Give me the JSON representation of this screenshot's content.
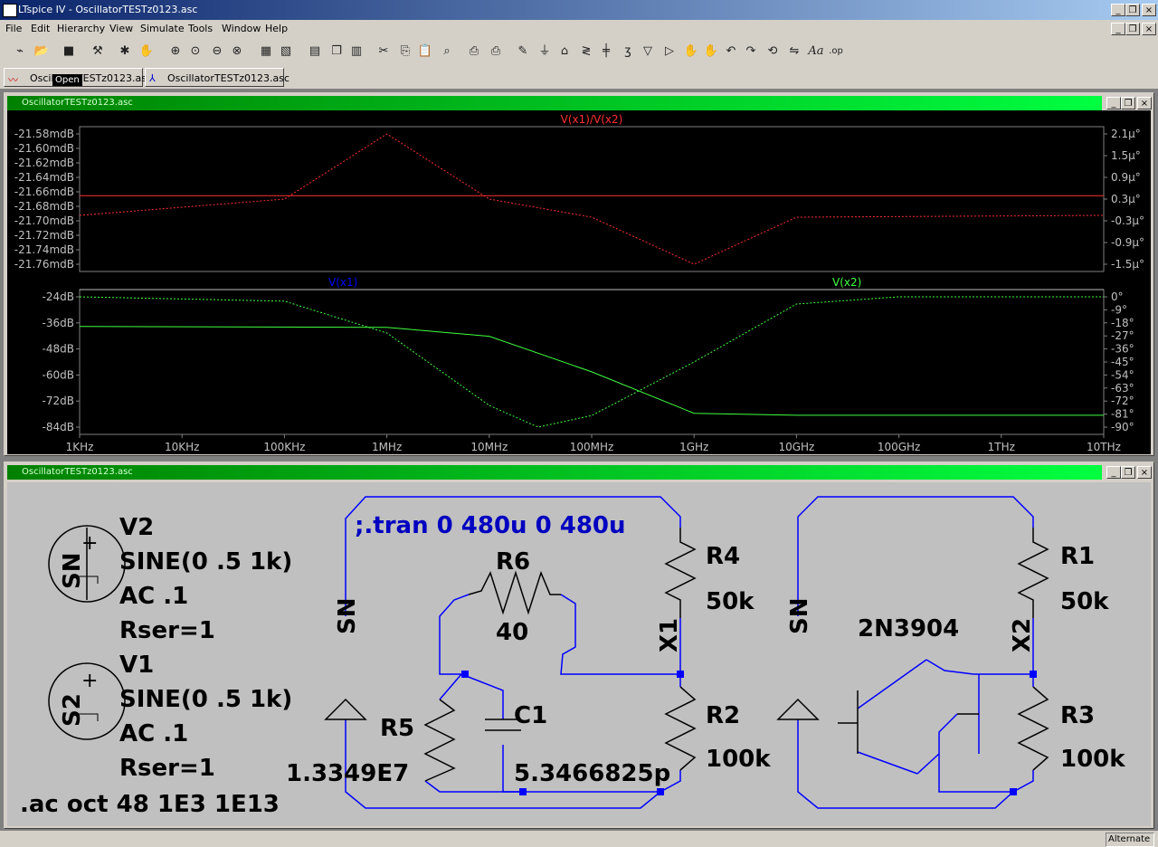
{
  "app": {
    "title": "LTspice IV - OscillatorTESTz0123.asc",
    "status": "Alternate"
  },
  "window_buttons": {
    "minimize": "_",
    "restore": "❐",
    "close": "×"
  },
  "menu": [
    "File",
    "Edit",
    "Hierarchy",
    "View",
    "Simulate",
    "Tools",
    "Window",
    "Help"
  ],
  "toolbar_icons": [
    "schematic-icon",
    "open-icon",
    "save-icon",
    "control-panel-icon",
    "run-icon",
    "halt-icon",
    "zoom-in-icon",
    "pan-icon",
    "zoom-out-icon",
    "zoom-fit-icon",
    "autorange-icon",
    "delete-trace-icon",
    "tile-horizontal-icon",
    "cascade-icon",
    "tile-vertical-icon",
    "cut-icon",
    "copy-icon",
    "paste-icon",
    "find-icon",
    "print-setup-icon",
    "print-icon",
    "wire-icon",
    "ground-icon",
    "label-icon",
    "resistor-icon",
    "capacitor-icon",
    "inductor-icon",
    "diode-icon",
    "component-icon",
    "move-icon",
    "drag-icon",
    "undo-icon",
    "redo-icon",
    "rotate-icon",
    "mirror-icon",
    "text-icon",
    "spice-directive-icon"
  ],
  "tabs": [
    {
      "label": "OscillatorTESTz0123.asc",
      "icon": "waveform-icon"
    },
    {
      "label": "OscillatorTESTz0123.asc",
      "icon": "schematic-icon"
    }
  ],
  "tooltip": "Open",
  "waveform_window": {
    "title": "OscillatorTESTz0123.asc"
  },
  "schematic_window": {
    "title": "OscillatorTESTz0123.asc"
  },
  "colors": {
    "plot_bg": "#000000",
    "trace_ratio": "#ff3030",
    "trace_v1": "#0000ff",
    "trace_v2": "#40ff40",
    "axis_text": "#c0c0c0",
    "schematic_wire": "#0000ff",
    "schematic_component": "#000000",
    "directive": "#0000c0"
  },
  "chart_data": [
    {
      "type": "line",
      "title": "",
      "series": [
        {
          "name": "V(x1)/V(x2)",
          "magnitude_db": -21.66,
          "phase_deg_approx": [
            [
              1000,
              -0.15
            ],
            [
              100000,
              0.3
            ],
            [
              1000000,
              2.1
            ],
            [
              10000000,
              0.3
            ],
            [
              100000000,
              -0.2
            ],
            [
              1000000000,
              -1.5
            ],
            [
              10000000000,
              -0.2
            ],
            [
              10000000000000,
              -0.15
            ]
          ]
        }
      ],
      "x_axis": {
        "scale": "log",
        "range": [
          1000,
          10000000000000
        ],
        "ticks": [
          "1KHz",
          "10KHz",
          "100KHz",
          "1MHz",
          "10MHz",
          "100MHz",
          "1GHz",
          "10GHz",
          "100GHz",
          "1THz",
          "10THz"
        ]
      },
      "y_left": {
        "ticks": [
          "-21.58mdB",
          "-21.60mdB",
          "-21.62mdB",
          "-21.64mdB",
          "-21.66mdB",
          "-21.68mdB",
          "-21.70mdB",
          "-21.72mdB",
          "-21.74mdB",
          "-21.76mdB"
        ],
        "range": [
          -21.76,
          -21.57
        ]
      },
      "y_right": {
        "ticks": [
          "2.1µ°",
          "1.5µ°",
          "0.9µ°",
          "0.3µ°",
          "-0.3µ°",
          "-0.9µ°",
          "-1.5µ°"
        ],
        "range": [
          -1.5,
          2.1
        ]
      }
    },
    {
      "type": "line",
      "title": "",
      "series": [
        {
          "name": "V(x1)",
          "magnitude_db": [
            [
              1000,
              -33
            ],
            [
              1000000,
              -33.5
            ],
            [
              10000000,
              -38
            ],
            [
              100000000,
              -56
            ],
            [
              1000000000,
              -77
            ],
            [
              10000000000,
              -78
            ],
            [
              10000000000000,
              -78
            ]
          ],
          "phase_deg": [
            [
              1000,
              0
            ],
            [
              100000,
              -3
            ],
            [
              1000000,
              -25
            ],
            [
              10000000,
              -75
            ],
            [
              30000000,
              -90
            ],
            [
              100000000,
              -82
            ],
            [
              1000000000,
              -45
            ],
            [
              10000000000,
              -5
            ],
            [
              100000000000,
              0
            ],
            [
              10000000000000,
              0
            ]
          ]
        },
        {
          "name": "V(x2)"
        }
      ],
      "x_axis": {
        "scale": "log",
        "range": [
          1000,
          10000000000000
        ],
        "ticks": [
          "1KHz",
          "10KHz",
          "100KHz",
          "1MHz",
          "10MHz",
          "100MHz",
          "1GHz",
          "10GHz",
          "100GHz",
          "1THz",
          "10THz"
        ]
      },
      "y_left": {
        "ticks": [
          "-24dB",
          "-36dB",
          "-48dB",
          "-60dB",
          "-72dB",
          "-84dB"
        ],
        "range": [
          -84,
          -18
        ]
      },
      "y_right": {
        "ticks": [
          "0°",
          "-9°",
          "-18°",
          "-27°",
          "-36°",
          "-45°",
          "-54°",
          "-63°",
          "-72°",
          "-81°",
          "-90°"
        ],
        "range": [
          -90,
          0
        ]
      }
    }
  ],
  "schematic": {
    "labels": {
      "v2": "V2",
      "v2_sine": "SINE(0 .5 1k)",
      "v2_ac": "AC .1",
      "v2_rser": "Rser=1",
      "v2_node": "SN",
      "v1": "V1",
      "v1_sine": "SINE(0 .5 1k)",
      "v1_ac": "AC .1",
      "v1_rser": "Rser=1",
      "v1_node": "S2",
      "ac_directive": ".ac oct 48 1E3 1E13",
      "tran_directive": ";.tran 0 480u 0 480u",
      "r6": "R6",
      "r6_val": "40",
      "r4": "R4",
      "r4_val": "50k",
      "x1": "X1",
      "sn1": "SN",
      "r5": "R5",
      "r5_val": "1.3349E7",
      "c1": "C1",
      "c1_val": "5.3466825p",
      "r2": "R2",
      "r2_val": "100k",
      "sn2": "SN",
      "q": "2N3904",
      "r1": "R1",
      "r1_val": "50k",
      "x2": "X2",
      "r3": "R3",
      "r3_val": "100k"
    }
  }
}
